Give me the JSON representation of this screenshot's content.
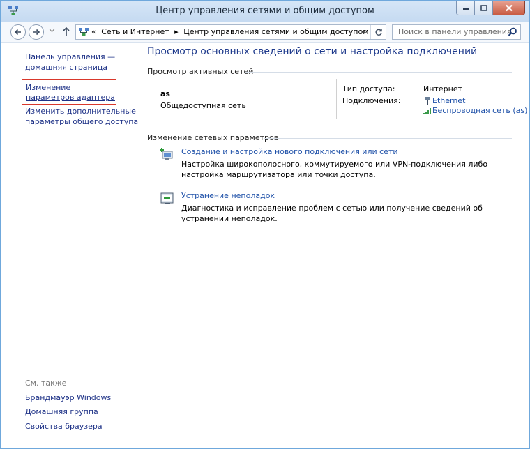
{
  "window": {
    "title": "Центр управления сетями и общим доступом"
  },
  "navigation": {
    "breadcrumb_overflow": "«",
    "breadcrumbs": [
      "Сеть и Интернет",
      "Центр управления сетями и общим доступом"
    ],
    "search_placeholder": "Поиск в панели управления"
  },
  "left_pane": {
    "home": "Панель управления — домашняя страница",
    "adapter_settings": "Изменение параметров адаптера",
    "advanced_sharing": "Изменить дополнительные параметры общего доступа",
    "see_also": "См. также",
    "see_also_links": [
      "Брандмауэр Windows",
      "Домашняя группа",
      "Свойства браузера"
    ]
  },
  "main": {
    "title": "Просмотр основных сведений о сети и настройка подключений",
    "active_networks_header": "Просмотр активных сетей",
    "network": {
      "name": "as",
      "type": "Общедоступная сеть",
      "access_type_label": "Тип доступа:",
      "access_type_value": "Интернет",
      "connections_label": "Подключения:",
      "connections": [
        "Ethernet",
        "Беспроводная сеть (as)"
      ]
    },
    "change_settings_header": "Изменение сетевых параметров",
    "tasks": [
      {
        "title": "Создание и настройка нового подключения или сети",
        "description": "Настройка широкополосного, коммутируемого или VPN-подключения либо настройка маршрутизатора или точки доступа."
      },
      {
        "title": "Устранение неполадок",
        "description": "Диагностика и исправление проблем с сетью или получение сведений об устранении неполадок."
      }
    ]
  },
  "colors": {
    "link": "#1e50a8",
    "title": "#1e3a8c",
    "highlight_border": "#d9382b",
    "close_button": "#c85b42"
  }
}
